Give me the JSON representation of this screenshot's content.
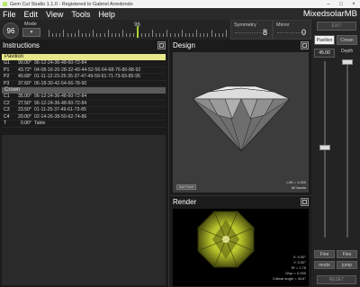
{
  "window": {
    "title": "Gem Cut Studio 1.1.0 - Registered to Gabriel Arredondo"
  },
  "menu": {
    "items": [
      "File",
      "Edit",
      "View",
      "Tools",
      "Help"
    ],
    "gem_name": "MixedsolarMB"
  },
  "toolbar": {
    "index_value": "96",
    "mode_label": "Mode",
    "dial_value": "96",
    "dial_fraction": 0.5,
    "symmetry_label": "Symmetry",
    "symmetry_value": "8",
    "mirror_label": "Mirror",
    "mirror_value": "0"
  },
  "right_panel": {
    "top_button": "EXIT",
    "pavilion_button": "Pavilion",
    "crown_button": "Crown",
    "angle_value": "45.00",
    "depth_label": "Depth",
    "fine_left": "Fine",
    "fine_right": "Fine",
    "mode_button": "mode",
    "jump_button": "jump",
    "bottom_button": "RESET"
  },
  "instructions": {
    "title": "Instructions",
    "groups": [
      {
        "name": "Pavilion",
        "rows": [
          {
            "id": "G1",
            "angle": "90.00°",
            "indexes": "96-12-24-36-48-60-72-84"
          },
          {
            "id": "P1",
            "angle": "43.72°",
            "indexes": "04-08-16-20-28-32-40-44-52-56-64-68-76-80-88-92"
          },
          {
            "id": "P2",
            "angle": "40.68°",
            "indexes": "01-11-12-23-25-35-37-47-49-59-61-71-73-83-85-95"
          },
          {
            "id": "P3",
            "angle": "37.60°",
            "indexes": "06-18-30-42-54-66-78-90"
          }
        ]
      },
      {
        "name": "Crown",
        "rows": [
          {
            "id": "C1",
            "angle": "35.00°",
            "indexes": "96-12-24-36-48-60-72-84"
          },
          {
            "id": "C2",
            "angle": "27.50°",
            "indexes": "96-12-24-36-48-60-72-84"
          },
          {
            "id": "C3",
            "angle": "23.50°",
            "indexes": "01-11-25-37-49-61-73-85"
          },
          {
            "id": "C4",
            "angle": "20.00°",
            "indexes": "02-14-26-38-50-62-74-86"
          },
          {
            "id": "T",
            "angle": "0.00°",
            "indexes": "Table"
          }
        ]
      }
    ]
  },
  "design": {
    "title": "Design",
    "add_facet": "Add Facet",
    "lw": "L/W = 1.000",
    "facets": "80 facets"
  },
  "render": {
    "title": "Render",
    "stats": [
      "X: 0.00°",
      "Y: 0.00°",
      "RI = 1.76",
      "Disp = 0.000",
      "Critical angle = 34.6°"
    ]
  },
  "colors": {
    "accent": "#a9d431",
    "pavilion_group": "#e6e68a",
    "gem": "#b5c02a"
  }
}
